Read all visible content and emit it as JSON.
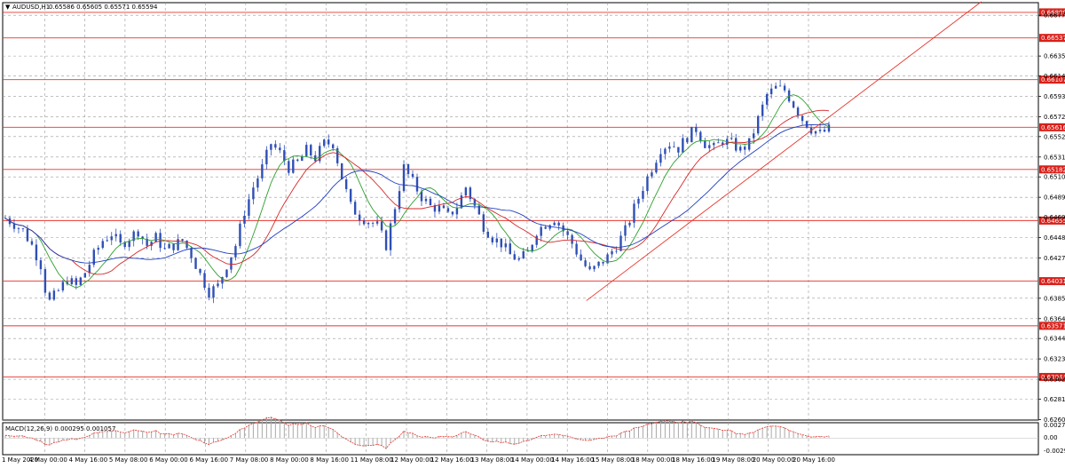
{
  "window": {
    "title": "AUDUSD,H1",
    "ohlc": "0.65586 0.65605 0.65571 0.65594"
  },
  "chart_data": {
    "type": "candlestick",
    "symbol": "AUDUSD",
    "timeframe": "H1",
    "ylim": [
      0.626,
      0.669
    ],
    "price_ticks": [
      "0.66770",
      "0.66350",
      "0.66145",
      "0.65935",
      "0.65725",
      "0.65520",
      "0.65310",
      "0.65105",
      "0.64895",
      "0.64690",
      "0.64480",
      "0.64270",
      "0.63855",
      "0.63645",
      "0.63440",
      "0.63230",
      "0.63020",
      "0.62815",
      "0.62605"
    ],
    "levels": [
      {
        "label": "0.66800",
        "price": 0.668
      },
      {
        "label": "0.66537",
        "price": 0.66537
      },
      {
        "label": "0.66107",
        "price": 0.66107
      },
      {
        "label": "0.65616",
        "price": 0.65616
      },
      {
        "label": "0.65182",
        "price": 0.65182
      },
      {
        "label": "0.64655",
        "price": 0.64655
      },
      {
        "label": "0.64031",
        "price": 0.64031
      },
      {
        "label": "0.63571",
        "price": 0.63571
      },
      {
        "label": "0.63044",
        "price": 0.63044
      }
    ],
    "trendline": {
      "from": {
        "time_index": 0.5636,
        "price": 0.6383
      },
      "to": {
        "time_index": 0.945,
        "price": 0.6691
      }
    },
    "time_labels": [
      "1 May 2020",
      "4 May 00:00",
      "4 May 16:00",
      "5 May 08:00",
      "6 May 00:00",
      "6 May 16:00",
      "7 May 08:00",
      "8 May 00:00",
      "8 May 16:00",
      "11 May 08:00",
      "12 May 00:00",
      "12 May 16:00",
      "13 May 08:00",
      "14 May 00:00",
      "14 May 16:00",
      "15 May 08:00",
      "18 May 00:00",
      "18 May 16:00",
      "19 May 08:00",
      "20 May 00:00",
      "20 May 16:00"
    ],
    "close_path": [
      [
        0,
        0.6468
      ],
      [
        2,
        0.6462
      ],
      [
        4,
        0.6455
      ],
      [
        6,
        0.644
      ],
      [
        8,
        0.642
      ],
      [
        9,
        0.6395
      ],
      [
        10,
        0.6382
      ],
      [
        12,
        0.6393
      ],
      [
        14,
        0.6405
      ],
      [
        16,
        0.6398
      ],
      [
        18,
        0.6412
      ],
      [
        20,
        0.643
      ],
      [
        22,
        0.6445
      ],
      [
        24,
        0.6452
      ],
      [
        26,
        0.644
      ],
      [
        28,
        0.6448
      ],
      [
        30,
        0.6455
      ],
      [
        32,
        0.644
      ],
      [
        34,
        0.6448
      ],
      [
        36,
        0.6435
      ],
      [
        38,
        0.644
      ],
      [
        40,
        0.6445
      ],
      [
        42,
        0.643
      ],
      [
        44,
        0.641
      ],
      [
        46,
        0.6392
      ],
      [
        48,
        0.6398
      ],
      [
        50,
        0.642
      ],
      [
        52,
        0.644
      ],
      [
        54,
        0.6475
      ],
      [
        56,
        0.65
      ],
      [
        58,
        0.652
      ],
      [
        60,
        0.6545
      ],
      [
        62,
        0.6535
      ],
      [
        64,
        0.652
      ],
      [
        66,
        0.6525
      ],
      [
        68,
        0.6538
      ],
      [
        70,
        0.653
      ],
      [
        72,
        0.6545
      ],
      [
        74,
        0.6545
      ],
      [
        76,
        0.651
      ],
      [
        78,
        0.648
      ],
      [
        80,
        0.647
      ],
      [
        82,
        0.6465
      ],
      [
        84,
        0.646
      ],
      [
        86,
        0.644
      ],
      [
        88,
        0.648
      ],
      [
        90,
        0.652
      ],
      [
        92,
        0.6505
      ],
      [
        94,
        0.649
      ],
      [
        96,
        0.648
      ],
      [
        98,
        0.6478
      ],
      [
        100,
        0.647
      ],
      [
        102,
        0.648
      ],
      [
        104,
        0.65
      ],
      [
        106,
        0.648
      ],
      [
        108,
        0.646
      ],
      [
        110,
        0.6448
      ],
      [
        112,
        0.6442
      ],
      [
        114,
        0.643
      ],
      [
        116,
        0.6425
      ],
      [
        118,
        0.6432
      ],
      [
        120,
        0.6455
      ],
      [
        122,
        0.6462
      ],
      [
        124,
        0.6468
      ],
      [
        126,
        0.6455
      ],
      [
        128,
        0.6442
      ],
      [
        130,
        0.6425
      ],
      [
        132,
        0.6412
      ],
      [
        134,
        0.642
      ],
      [
        136,
        0.6428
      ],
      [
        138,
        0.644
      ],
      [
        140,
        0.6455
      ],
      [
        142,
        0.6478
      ],
      [
        144,
        0.65
      ],
      [
        146,
        0.652
      ],
      [
        148,
        0.654
      ],
      [
        150,
        0.6545
      ],
      [
        152,
        0.654
      ],
      [
        154,
        0.6552
      ],
      [
        156,
        0.656
      ],
      [
        158,
        0.6545
      ],
      [
        160,
        0.654
      ],
      [
        162,
        0.6548
      ],
      [
        164,
        0.6545
      ],
      [
        166,
        0.6538
      ],
      [
        168,
        0.6545
      ],
      [
        170,
        0.657
      ],
      [
        172,
        0.6595
      ],
      [
        174,
        0.6602
      ],
      [
        176,
        0.66
      ],
      [
        178,
        0.6585
      ],
      [
        180,
        0.657
      ],
      [
        182,
        0.656
      ],
      [
        184,
        0.6555
      ],
      [
        186,
        0.65594
      ]
    ],
    "macd": {
      "label": "MACD(12,26,9) 0.000295 0.001057",
      "ticks": [
        "0.002762",
        "0.00",
        "-0.00299"
      ],
      "ylim": [
        -0.00299,
        0.002762
      ]
    }
  },
  "colors": {
    "bg": "#ffffff",
    "candle": "#2f4fb5",
    "level": "#e8352b",
    "trend": "#e8352b",
    "grid": "#9a9a9a",
    "ma_fast": "#2ca02c",
    "ma_mid": "#d62728",
    "ma_slow": "#1f3fbf",
    "label_bg": "#d8201a"
  }
}
